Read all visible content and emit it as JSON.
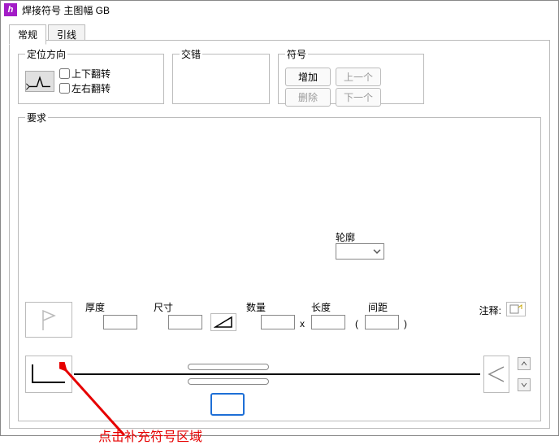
{
  "title": "焊接符号 主图幅 GB",
  "tabs": {
    "general": "常规",
    "leader": "引线"
  },
  "orient": {
    "legend": "定位方向",
    "flip_v": "上下翻转",
    "flip_h": "左右翻转"
  },
  "stagger": {
    "legend": "交错"
  },
  "symbol": {
    "legend": "符号",
    "add": "增加",
    "prev": "上一个",
    "delete": "删除",
    "next": "下一个"
  },
  "req": {
    "legend": "要求"
  },
  "contour": {
    "label": "轮廓"
  },
  "row": {
    "thickness": "厚度",
    "size": "尺寸",
    "qty": "数量",
    "length": "长度",
    "pitch": "间距",
    "note": "注释:",
    "x": "x",
    "lparen": "(",
    "rparen": ")"
  },
  "annotation": "点击补充符号区域"
}
